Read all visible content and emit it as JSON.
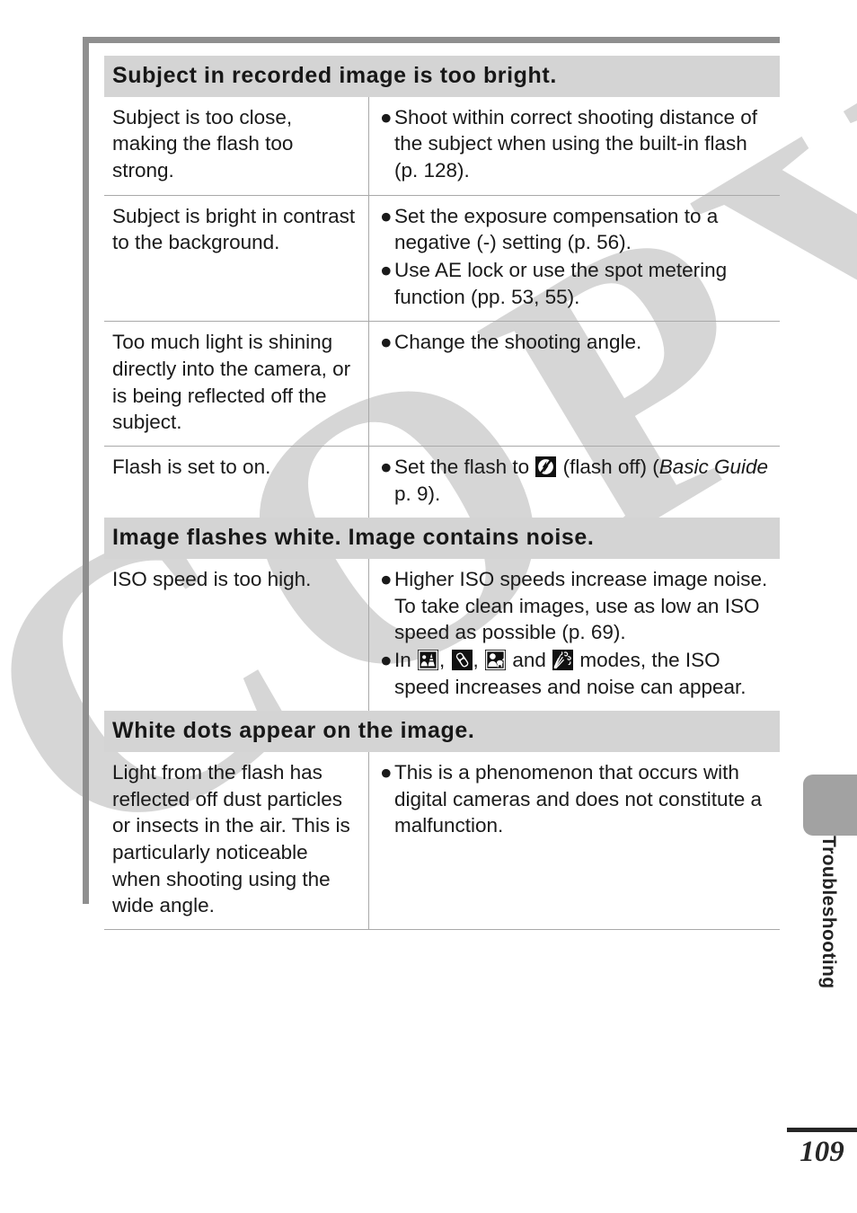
{
  "page": {
    "number": "109",
    "side_tab_label": "Troubleshooting",
    "watermark_text": "COPY"
  },
  "sections": [
    {
      "heading": "Subject in recorded image is too bright.",
      "rows": [
        {
          "cause": "Subject is too close, making the flash too strong.",
          "actions": [
            {
              "pre": "Shoot within correct shooting distance of the subject when using the built-in flash (p. 128).",
              "icon": null,
              "post": ""
            }
          ]
        },
        {
          "cause": "Subject is bright in contrast to the background.",
          "actions": [
            {
              "pre": "Set the exposure compensation to a negative (-) setting (p. 56).",
              "icon": null,
              "post": ""
            },
            {
              "pre": "Use AE lock or use the spot metering function (pp. 53, 55).",
              "icon": null,
              "post": ""
            }
          ]
        },
        {
          "cause": "Too much light is shining directly into the camera, or is being reflected off the subject.",
          "actions": [
            {
              "pre": "Change the shooting angle.",
              "icon": null,
              "post": ""
            }
          ]
        },
        {
          "cause": "Flash is set to on.",
          "actions": [
            {
              "pre": "Set the flash to ",
              "icon": "flash-off-icon",
              "post": " (flash off) (Basic Guide p. 9).",
              "post_italic_prefix": "Basic Guide",
              "post_plain_head": " (flash off) (",
              "post_plain_tail": " p. 9)."
            }
          ]
        }
      ]
    },
    {
      "heading": "Image flashes white. Image contains noise.",
      "rows": [
        {
          "cause": "ISO speed is too high.",
          "actions": [
            {
              "pre": "Higher ISO speeds increase image noise. To take clean images, use as low an ISO speed as possible (p. 69).",
              "icon": null,
              "post": ""
            },
            {
              "pre": "In ",
              "icons": [
                "night-snapshot-mode-icon",
                "indoor-mode-icon",
                "kids-and-pets-mode-icon",
                "fireworks-mode-icon"
              ],
              "sep1": ", ",
              "sep2": ", ",
              "sep3": " and ",
              "post": " modes, the ISO speed increases and noise can appear."
            }
          ]
        }
      ]
    },
    {
      "heading": "White dots appear on the image.",
      "rows": [
        {
          "cause": "Light from the flash has reflected off dust particles or insects in the air. This is particularly noticeable when shooting using the wide angle.",
          "actions": [
            {
              "pre": "This is a phenomenon that occurs with digital cameras and does not constitute a malfunction.",
              "icon": null,
              "post": ""
            }
          ]
        }
      ]
    }
  ],
  "colors": {
    "section_header_bg": "#d4d4d4",
    "frame_gray": "#8f8f8f",
    "rule_gray": "#a9a9a9",
    "watermark_gray": "#d6d6d6",
    "tab_gray": "#a2a2a2",
    "text": "#1a1a1a"
  },
  "bullet_glyph": "●"
}
